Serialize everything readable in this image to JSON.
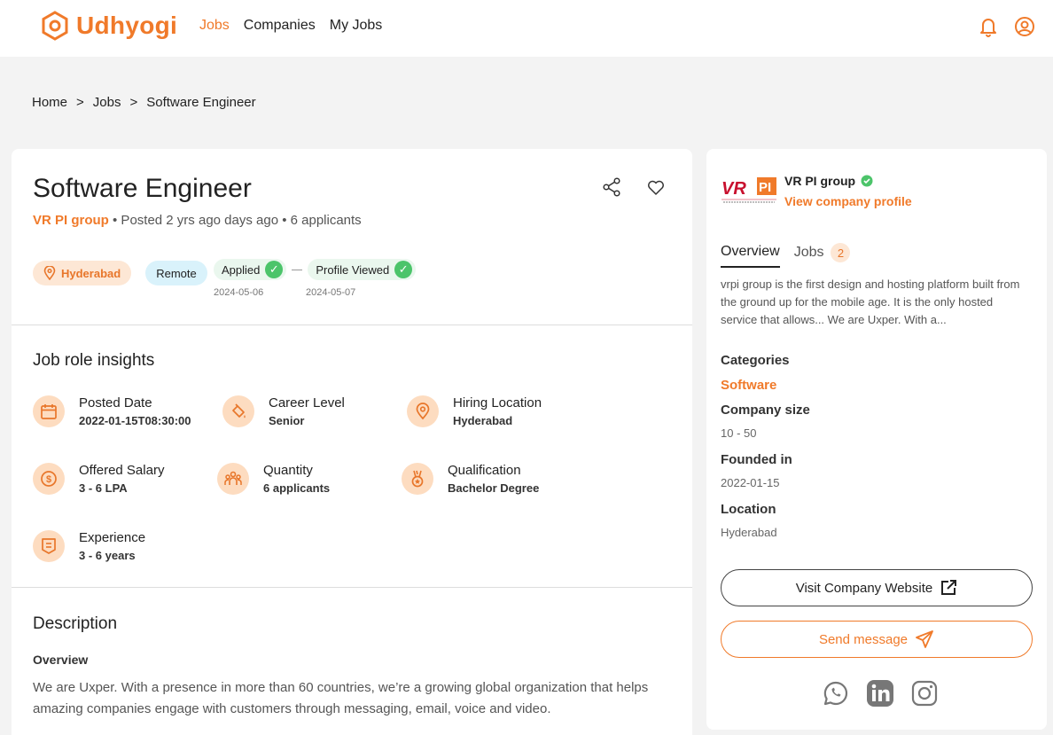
{
  "header": {
    "brand": "Udhyogi",
    "nav": [
      "Jobs",
      "Companies",
      "My Jobs"
    ],
    "active_nav": "Jobs",
    "icons": [
      "bell-icon",
      "user-circle-icon"
    ]
  },
  "breadcrumb": [
    "Home",
    ">",
    "Jobs",
    ">",
    "Software Engineer"
  ],
  "job": {
    "title": "Software Engineer",
    "company": "VR PI group",
    "posted": "• Posted 2 yrs ago days ago • 6 applicants",
    "location_tag": "Hyderabad",
    "remote_tag": "Remote",
    "status": [
      {
        "label": "Applied",
        "date": "2024-05-06"
      },
      {
        "label": "Profile Viewed",
        "date": "2024-05-07"
      }
    ]
  },
  "insights": {
    "title": "Job role insights",
    "items": [
      {
        "label": "Posted Date",
        "value": "2022-01-15T08:30:00",
        "icon": "calendar-icon"
      },
      {
        "label": "Career Level",
        "value": "Senior",
        "icon": "paint-bucket-icon"
      },
      {
        "label": "Hiring Location",
        "value": "Hyderabad",
        "icon": "location-pin-icon"
      },
      {
        "label": "Offered Salary",
        "value": "3 - 6 LPA",
        "icon": "dollar-coin-icon"
      },
      {
        "label": "Quantity",
        "value": "6 applicants",
        "icon": "people-icon"
      },
      {
        "label": "Qualification",
        "value": "Bachelor Degree",
        "icon": "medal-icon"
      },
      {
        "label": "Experience",
        "value": "3 - 6 years",
        "icon": "badge-icon"
      }
    ]
  },
  "description": {
    "title": "Description",
    "subtitle": "Overview",
    "text": "We are Uxper. With a presence in more than 60 countries, we’re a growing global organization that helps amazing companies engage with customers through messaging, email, voice and video."
  },
  "company_card": {
    "name": "VR PI group",
    "profile_link": "View company profile",
    "tabs": [
      {
        "label": "Overview"
      },
      {
        "label": "Jobs",
        "count": "2"
      }
    ],
    "about": "vrpi group is the first design and hosting platform built from the ground up for the mobile age. It is the only hosted service that allows... We are Uxper. With a...",
    "categories_label": "Categories",
    "categories_value": "Software",
    "size_label": "Company size",
    "size_value": "10 - 50",
    "founded_label": "Founded in",
    "founded_value": "2022-01-15",
    "location_label": "Location",
    "location_value": "Hyderabad",
    "website_button": "Visit Company Website",
    "message_button": "Send message",
    "socials": [
      "whatsapp-icon",
      "linkedin-icon",
      "instagram-icon"
    ]
  },
  "colors": {
    "accent": "#f07a2a",
    "success": "#4cc46a",
    "page_bg": "#f3f3f3"
  }
}
